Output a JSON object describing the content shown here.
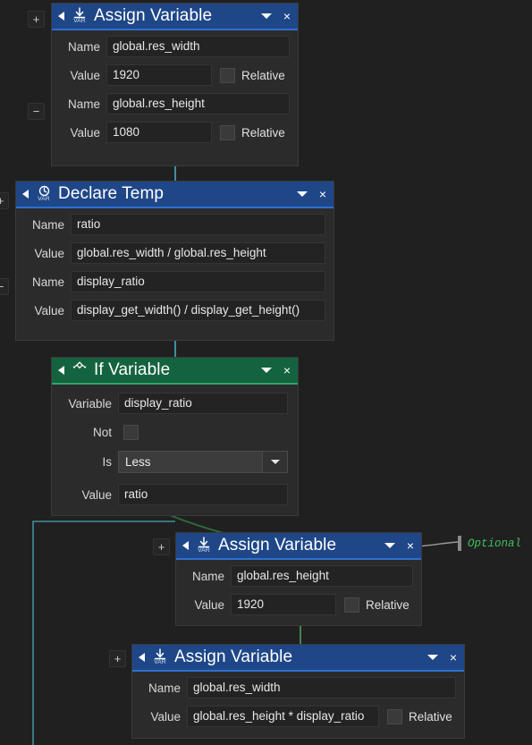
{
  "canvas": {
    "background": "#202020",
    "accent_blue": "#1f4788",
    "accent_green": "#14633f",
    "wire_teal": "#3f8f9e",
    "wire_green": "#2f6b3a",
    "comment_green": "#3fbf5f"
  },
  "labels": {
    "name": "Name",
    "value": "Value",
    "relative": "Relative",
    "variable": "Variable",
    "not": "Not",
    "is": "Is",
    "plus": "+",
    "minus": "−",
    "close": "×",
    "var_tag": "VAR"
  },
  "nodes": [
    {
      "id": "assign-variable-1",
      "title": "Assign Variable",
      "color": "blue",
      "icon": "assign-variable-icon",
      "rows": [
        {
          "label": "Name",
          "value": "global.res_width",
          "relative": false,
          "has_relative": false
        },
        {
          "label": "Value",
          "value": "1920",
          "relative": false,
          "has_relative": true
        },
        {
          "label": "Name",
          "value": "global.res_height",
          "relative": false,
          "has_relative": false
        },
        {
          "label": "Value",
          "value": "1080",
          "relative": false,
          "has_relative": true
        }
      ]
    },
    {
      "id": "declare-temp",
      "title": "Declare Temp",
      "color": "blue",
      "icon": "declare-temp-icon",
      "rows": [
        {
          "label": "Name",
          "value": "ratio",
          "has_relative": false
        },
        {
          "label": "Value",
          "value": "global.res_width / global.res_height",
          "has_relative": false
        },
        {
          "label": "Name",
          "value": "display_ratio",
          "has_relative": false
        },
        {
          "label": "Value",
          "value": "display_get_width() / display_get_height()",
          "has_relative": false
        }
      ]
    },
    {
      "id": "if-variable",
      "title": "If Variable",
      "color": "green",
      "icon": "if-variable-icon",
      "variable_label": "Variable",
      "variable_value": "display_ratio",
      "not_label": "Not",
      "not_checked": false,
      "is_label": "Is",
      "is_value": "Less",
      "is_options": [
        "Less"
      ],
      "value_label": "Value",
      "value_value": "ratio"
    },
    {
      "id": "assign-variable-2",
      "title": "Assign Variable",
      "color": "blue",
      "icon": "assign-variable-icon",
      "rows": [
        {
          "label": "Name",
          "value": "global.res_height",
          "relative": false,
          "has_relative": false
        },
        {
          "label": "Value",
          "value": "1920",
          "relative": false,
          "has_relative": true
        }
      ]
    },
    {
      "id": "assign-variable-3",
      "title": "Assign Variable",
      "color": "blue",
      "icon": "assign-variable-icon",
      "rows": [
        {
          "label": "Name",
          "value": "global.res_width",
          "relative": false,
          "has_relative": false
        },
        {
          "label": "Value",
          "value": "global.res_height * display_ratio",
          "relative": false,
          "has_relative": true
        }
      ]
    }
  ],
  "comments": [
    {
      "id": "optional-comment",
      "text": "Optional"
    }
  ]
}
